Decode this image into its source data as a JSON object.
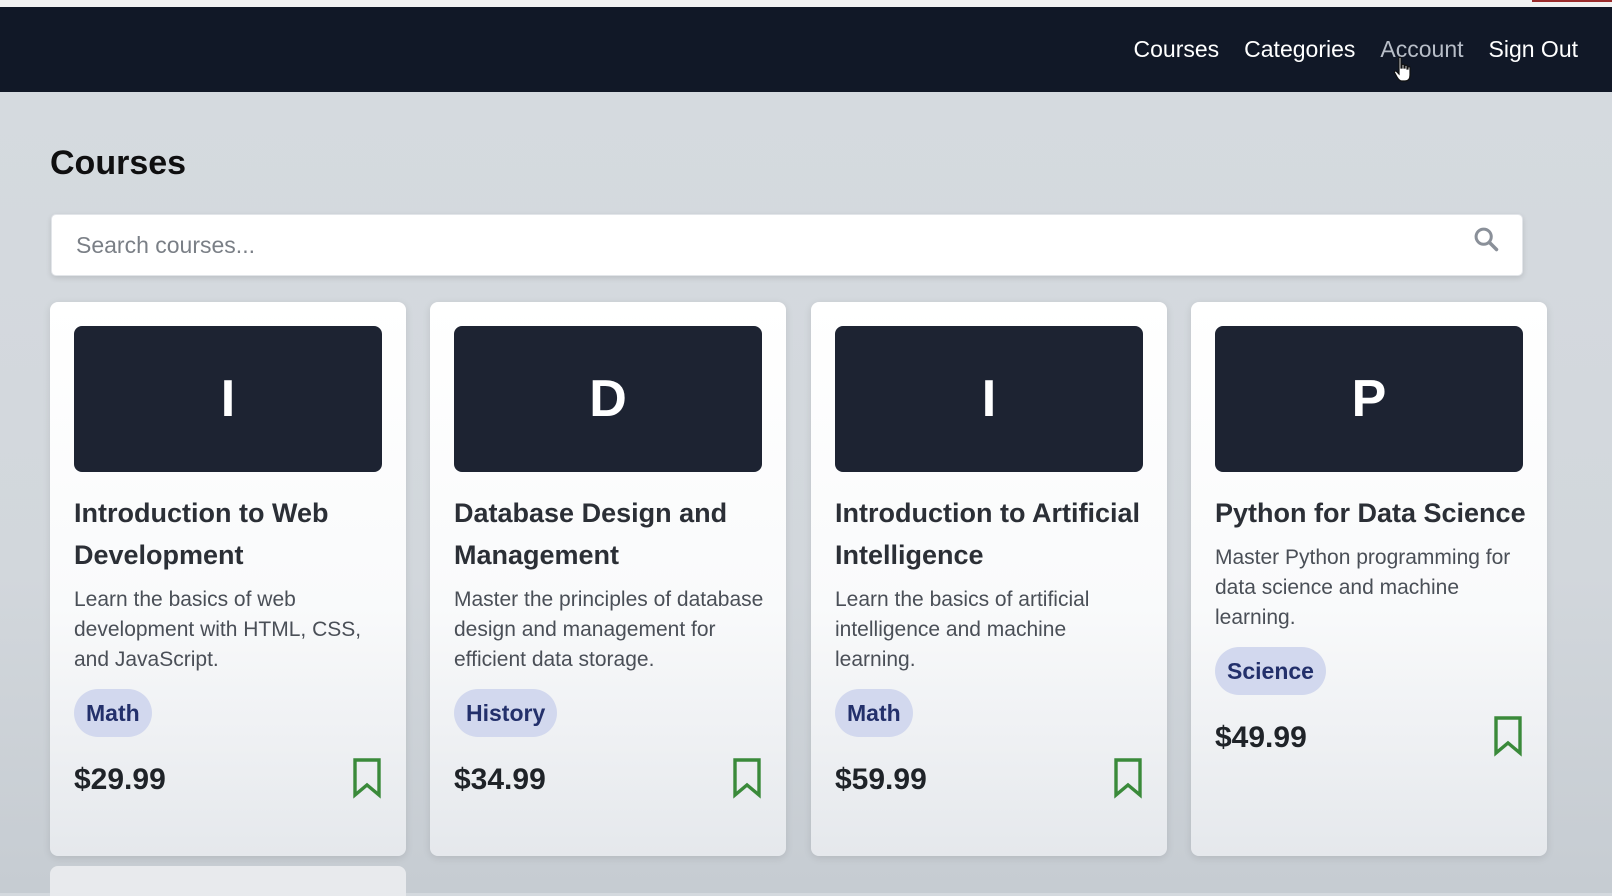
{
  "nav": {
    "links": [
      "Courses",
      "Categories",
      "Account",
      "Sign Out"
    ]
  },
  "page": {
    "title": "Courses"
  },
  "search": {
    "placeholder": "Search courses..."
  },
  "colors": {
    "navbar": "#111827",
    "thumb": "#1d2332",
    "badge_bg": "#d2d8ee",
    "badge_text": "#23306b",
    "bookmark": "#3a8a3a"
  },
  "courses": [
    {
      "initial": "I",
      "title": "Introduction to Web Development",
      "description": "Learn the basics of web development with HTML, CSS, and JavaScript.",
      "category": "Math",
      "price": "$29.99"
    },
    {
      "initial": "D",
      "title": "Database Design and Management",
      "description": "Master the principles of database design and management for efficient data storage.",
      "category": "History",
      "price": "$34.99"
    },
    {
      "initial": "I",
      "title": "Introduction to Artificial Intelligence",
      "description": "Learn the basics of artificial intelligence and machine learning.",
      "category": "Math",
      "price": "$59.99"
    },
    {
      "initial": "P",
      "title": "Python for Data Science",
      "description": "Master Python programming for data science and machine learning.",
      "category": "Science",
      "price": "$49.99"
    }
  ]
}
